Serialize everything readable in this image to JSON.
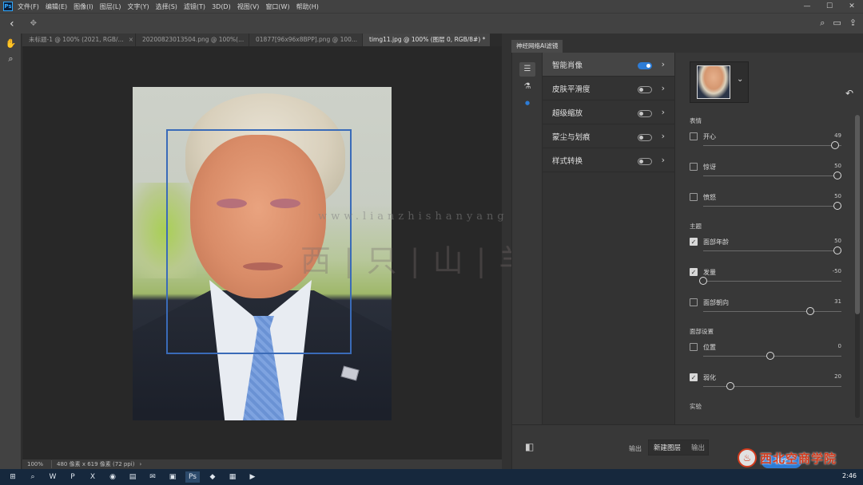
{
  "menubar": {
    "app_logo": "Ps",
    "items": [
      "文件(F)",
      "编辑(E)",
      "图像(I)",
      "图层(L)",
      "文字(Y)",
      "选择(S)",
      "滤镜(T)",
      "3D(D)",
      "视图(V)",
      "窗口(W)",
      "帮助(H)"
    ],
    "window_controls": [
      "—",
      "☐",
      "✕"
    ]
  },
  "optionsbar": {
    "back_icon": "chevron-left-icon",
    "tool_icon": "move-tool-icon",
    "right_icons": [
      "search-icon",
      "workspace-icon",
      "share-icon"
    ]
  },
  "tools": [
    "hand-icon",
    "zoom-icon"
  ],
  "tabs": [
    {
      "label": "未标题-1 @ 100% (2021, RGB/...",
      "close": "×",
      "active": false
    },
    {
      "label": "20200823013504.png @ 100%(...",
      "close": "×",
      "active": false
    },
    {
      "label": "01877[96x96x8BPP].png @ 100...",
      "close": "×",
      "active": false
    },
    {
      "label": "timg11.jpg @ 100% (图层 0, RGB/8#) *",
      "close": "×",
      "active": true
    }
  ],
  "canvas": {
    "watermark_url": "www.lianzhishanyang",
    "watermark_cn": "西|只|山|羊"
  },
  "statusbar": {
    "zoom": "100%",
    "doc_info": "480 像素 x 619 像素 (72 ppi)",
    "arrow": "›"
  },
  "neural_filters": {
    "tab_title": "神经网络AI滤镜",
    "filters": [
      {
        "label": "智能肖像",
        "enabled": true,
        "active": true
      },
      {
        "label": "皮肤平滑度",
        "enabled": false,
        "active": false
      },
      {
        "label": "超级缩放",
        "enabled": false,
        "active": false
      },
      {
        "label": "蒙尘与划痕",
        "enabled": false,
        "active": false
      },
      {
        "label": "样式转换",
        "enabled": false,
        "active": false
      }
    ],
    "sections": {
      "expression": "表情",
      "theme": "主题",
      "layout": "面部设置",
      "experimental": "实验"
    },
    "sliders": [
      {
        "label": "开心",
        "value": "49",
        "fraction": 0.98,
        "checked": false
      },
      {
        "label": "惊讶",
        "value": "50",
        "fraction": 1.0,
        "checked": false
      },
      {
        "label": "愤怒",
        "value": "50",
        "fraction": 1.0,
        "checked": false
      },
      {
        "label": "面部年龄",
        "value": "50",
        "fraction": 1.0,
        "checked": true
      },
      {
        "label": "发量",
        "value": "-50",
        "fraction": 0.0,
        "checked": true
      },
      {
        "label": "面部朝向",
        "value": "31",
        "fraction": 0.8,
        "checked": false
      },
      {
        "label": "位置",
        "value": "0",
        "fraction": 0.5,
        "checked": false
      },
      {
        "label": "弱化",
        "value": "20",
        "fraction": 0.2,
        "checked": true
      }
    ],
    "output_label": "输出",
    "output_value": "新建图层",
    "output_suffix": "输出",
    "ok_label": "确定",
    "brand": "西北空商学院"
  },
  "taskbar": {
    "icons": [
      "windows-icon",
      "search-icon",
      "word-icon",
      "ppt-icon",
      "excel-icon",
      "chrome-icon",
      "folder-icon",
      "mail-icon",
      "desktop-icon",
      "photoshop-icon",
      "vpn-icon",
      "calculator-icon",
      "player-icon"
    ],
    "clock": "2:46"
  }
}
